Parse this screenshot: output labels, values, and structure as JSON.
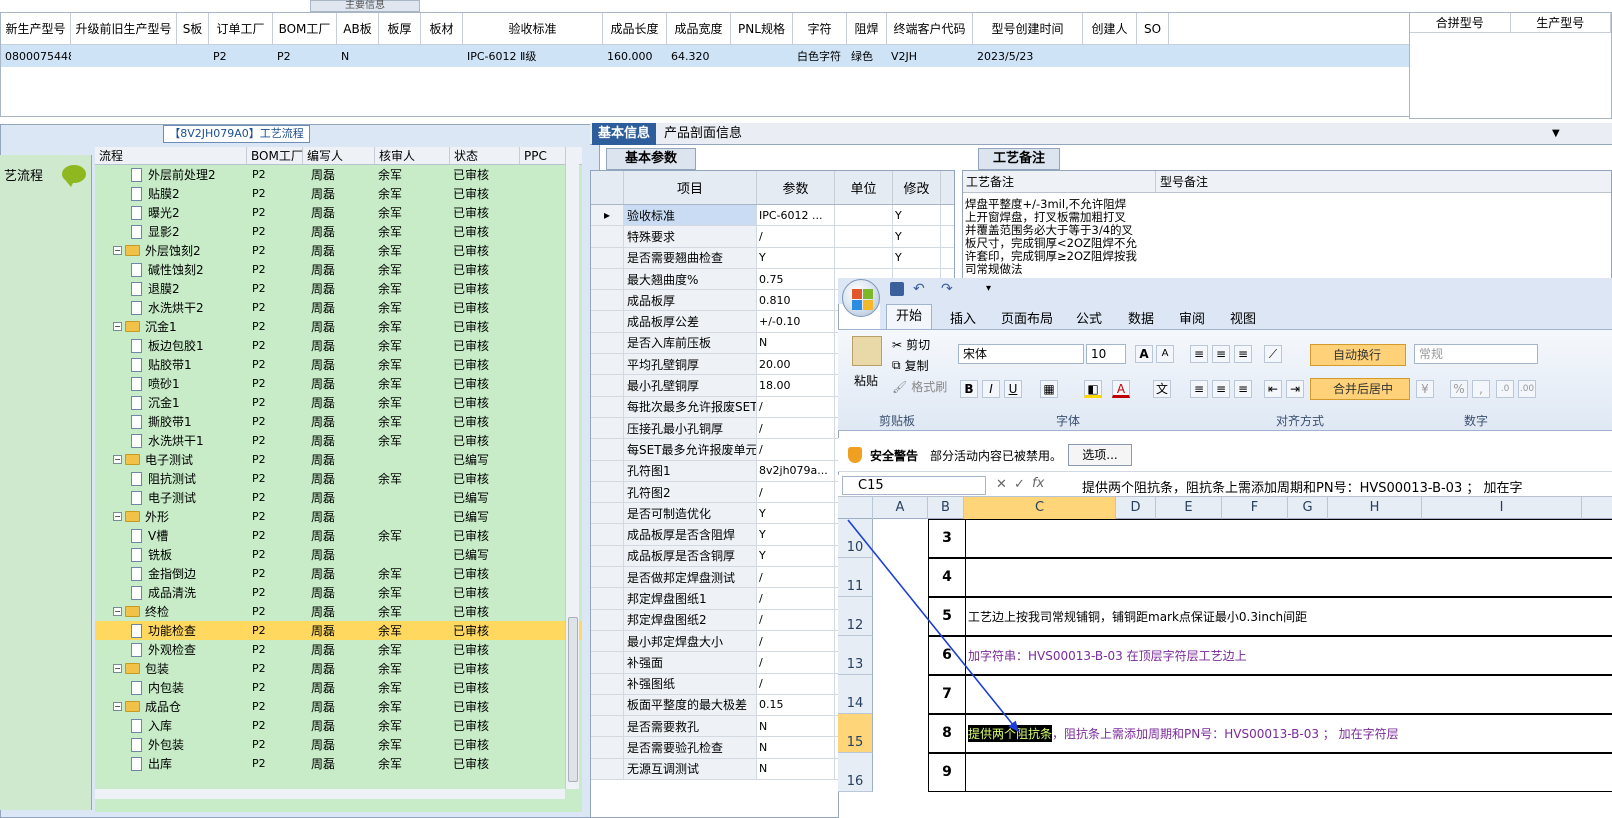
{
  "window": {
    "title_tab": "主要信息"
  },
  "top_table": {
    "headers": [
      "新生产型号",
      "升级前旧生产型号",
      "S板",
      "订单工厂",
      "BOM工厂",
      "AB板",
      "板厚",
      "板材",
      "验收标准",
      "成品长度",
      "成品宽度",
      "PNL规格",
      "字符",
      "阻焊",
      "终端客户代码",
      "型号创建时间",
      "创建人",
      "SO"
    ],
    "row": [
      "0800075448",
      "",
      "",
      "P2",
      "P2",
      "N",
      "",
      "",
      "IPC-6012 Ⅱ级",
      "160.000",
      "64.320",
      "",
      "白色字符",
      "绿色",
      "V2JH",
      "2023/5/23",
      "",
      ""
    ]
  },
  "merge_table": {
    "headers": [
      "合拼型号",
      "生产型号"
    ]
  },
  "process": {
    "title": "【8V2JH079A0】工艺流程",
    "nav_label": "艺流程",
    "headers": [
      "流程",
      "BOM工厂",
      "编写人",
      "核审人",
      "状态",
      "PPC"
    ],
    "rows": [
      {
        "level": 2,
        "type": "doc",
        "name": "外层前处理2",
        "bom": "P2",
        "writer": "周磊",
        "auditor": "余军",
        "status": "已审核"
      },
      {
        "level": 2,
        "type": "doc",
        "name": "贴膜2",
        "bom": "P2",
        "writer": "周磊",
        "auditor": "余军",
        "status": "已审核"
      },
      {
        "level": 2,
        "type": "doc",
        "name": "曝光2",
        "bom": "P2",
        "writer": "周磊",
        "auditor": "余军",
        "status": "已审核"
      },
      {
        "level": 2,
        "type": "doc",
        "name": "显影2",
        "bom": "P2",
        "writer": "周磊",
        "auditor": "余军",
        "status": "已审核"
      },
      {
        "level": 1,
        "type": "folder",
        "name": "外层蚀刻2",
        "bom": "P2",
        "writer": "周磊",
        "auditor": "余军",
        "status": "已审核"
      },
      {
        "level": 2,
        "type": "doc",
        "name": "碱性蚀刻2",
        "bom": "P2",
        "writer": "周磊",
        "auditor": "余军",
        "status": "已审核"
      },
      {
        "level": 2,
        "type": "doc",
        "name": "退膜2",
        "bom": "P2",
        "writer": "周磊",
        "auditor": "余军",
        "status": "已审核"
      },
      {
        "level": 2,
        "type": "doc",
        "name": "水洗烘干2",
        "bom": "P2",
        "writer": "周磊",
        "auditor": "余军",
        "status": "已审核"
      },
      {
        "level": 1,
        "type": "folder",
        "name": "沉金1",
        "bom": "P2",
        "writer": "周磊",
        "auditor": "余军",
        "status": "已审核"
      },
      {
        "level": 2,
        "type": "doc",
        "name": "板边包胶1",
        "bom": "P2",
        "writer": "周磊",
        "auditor": "余军",
        "status": "已审核"
      },
      {
        "level": 2,
        "type": "doc",
        "name": "贴胶带1",
        "bom": "P2",
        "writer": "周磊",
        "auditor": "余军",
        "status": "已审核"
      },
      {
        "level": 2,
        "type": "doc",
        "name": "喷砂1",
        "bom": "P2",
        "writer": "周磊",
        "auditor": "余军",
        "status": "已审核"
      },
      {
        "level": 2,
        "type": "doc",
        "name": "沉金1",
        "bom": "P2",
        "writer": "周磊",
        "auditor": "余军",
        "status": "已审核"
      },
      {
        "level": 2,
        "type": "doc",
        "name": "撕胶带1",
        "bom": "P2",
        "writer": "周磊",
        "auditor": "余军",
        "status": "已审核"
      },
      {
        "level": 2,
        "type": "doc",
        "name": "水洗烘干1",
        "bom": "P2",
        "writer": "周磊",
        "auditor": "余军",
        "status": "已审核"
      },
      {
        "level": 1,
        "type": "folder",
        "name": "电子测试",
        "bom": "P2",
        "writer": "周磊",
        "auditor": "",
        "status": "已编写"
      },
      {
        "level": 2,
        "type": "doc",
        "name": "阻抗测试",
        "bom": "P2",
        "writer": "周磊",
        "auditor": "余军",
        "status": "已审核"
      },
      {
        "level": 2,
        "type": "doc",
        "name": "电子测试",
        "bom": "P2",
        "writer": "周磊",
        "auditor": "",
        "status": "已编写"
      },
      {
        "level": 1,
        "type": "folder",
        "name": "外形",
        "bom": "P2",
        "writer": "周磊",
        "auditor": "",
        "status": "已编写"
      },
      {
        "level": 2,
        "type": "doc",
        "name": "V槽",
        "bom": "P2",
        "writer": "周磊",
        "auditor": "余军",
        "status": "已审核"
      },
      {
        "level": 2,
        "type": "doc",
        "name": "铣板",
        "bom": "P2",
        "writer": "周磊",
        "auditor": "",
        "status": "已编写"
      },
      {
        "level": 2,
        "type": "doc",
        "name": "金指倒边",
        "bom": "P2",
        "writer": "周磊",
        "auditor": "余军",
        "status": "已审核"
      },
      {
        "level": 2,
        "type": "doc",
        "name": "成品清洗",
        "bom": "P2",
        "writer": "周磊",
        "auditor": "余军",
        "status": "已审核"
      },
      {
        "level": 1,
        "type": "folder",
        "name": "终检",
        "bom": "P2",
        "writer": "周磊",
        "auditor": "余军",
        "status": "已审核"
      },
      {
        "level": 2,
        "type": "doc",
        "name": "功能检查",
        "bom": "P2",
        "writer": "周磊",
        "auditor": "余军",
        "status": "已审核",
        "selected": true
      },
      {
        "level": 2,
        "type": "doc",
        "name": "外观检查",
        "bom": "P2",
        "writer": "周磊",
        "auditor": "余军",
        "status": "已审核"
      },
      {
        "level": 1,
        "type": "folder",
        "name": "包装",
        "bom": "P2",
        "writer": "周磊",
        "auditor": "余军",
        "status": "已审核"
      },
      {
        "level": 2,
        "type": "doc",
        "name": "内包装",
        "bom": "P2",
        "writer": "周磊",
        "auditor": "余军",
        "status": "已审核"
      },
      {
        "level": 1,
        "type": "folder",
        "name": "成品仓",
        "bom": "P2",
        "writer": "周磊",
        "auditor": "余军",
        "status": "已审核"
      },
      {
        "level": 2,
        "type": "doc",
        "name": "入库",
        "bom": "P2",
        "writer": "周磊",
        "auditor": "余军",
        "status": "已审核"
      },
      {
        "level": 2,
        "type": "doc",
        "name": "外包装",
        "bom": "P2",
        "writer": "周磊",
        "auditor": "余军",
        "status": "已审核"
      },
      {
        "level": 2,
        "type": "doc",
        "name": "出库",
        "bom": "P2",
        "writer": "周磊",
        "auditor": "余军",
        "status": "已审核"
      }
    ]
  },
  "info": {
    "tabs": [
      "基本信息",
      "产品剖面信息"
    ],
    "param_tab": "基本参数",
    "remark_tab": "工艺备注",
    "param_headers": [
      "项目",
      "参数",
      "单位",
      "修改"
    ],
    "params": [
      {
        "name": "验收标准",
        "value": "IPC-6012 ...",
        "unit": "",
        "mod": "Y"
      },
      {
        "name": "特殊要求",
        "value": "/",
        "unit": "",
        "mod": "Y"
      },
      {
        "name": "是否需要翘曲检查",
        "value": "Y",
        "unit": "",
        "mod": "Y"
      },
      {
        "name": "最大翘曲度%",
        "value": "0.75",
        "unit": "",
        "mod": ""
      },
      {
        "name": "成品板厚",
        "value": "0.810",
        "unit": "",
        "mod": ""
      },
      {
        "name": "成品板厚公差",
        "value": "+/-0.10",
        "unit": "",
        "mod": ""
      },
      {
        "name": "是否入库前压板",
        "value": "N",
        "unit": "",
        "mod": ""
      },
      {
        "name": "平均孔壁铜厚",
        "value": "20.00",
        "unit": "",
        "mod": ""
      },
      {
        "name": "最小孔壁铜厚",
        "value": "18.00",
        "unit": "",
        "mod": ""
      },
      {
        "name": "每批次最多允许报废SET",
        "value": "/",
        "unit": "",
        "mod": ""
      },
      {
        "name": "压接孔最小孔铜厚",
        "value": "/",
        "unit": "",
        "mod": ""
      },
      {
        "name": "每SET最多允许报废单元",
        "value": "/",
        "unit": "",
        "mod": ""
      },
      {
        "name": "孔符图1",
        "value": "8v2jh079a...",
        "unit": "",
        "mod": ""
      },
      {
        "name": "孔符图2",
        "value": "/",
        "unit": "",
        "mod": ""
      },
      {
        "name": "是否可制造优化",
        "value": "Y",
        "unit": "",
        "mod": ""
      },
      {
        "name": "成品板厚是否含阻焊",
        "value": "Y",
        "unit": "",
        "mod": ""
      },
      {
        "name": "成品板厚是否含铜厚",
        "value": "Y",
        "unit": "",
        "mod": ""
      },
      {
        "name": "是否做邦定焊盘测试",
        "value": "/",
        "unit": "",
        "mod": ""
      },
      {
        "name": "邦定焊盘图纸1",
        "value": "/",
        "unit": "",
        "mod": ""
      },
      {
        "name": "邦定焊盘图纸2",
        "value": "/",
        "unit": "",
        "mod": ""
      },
      {
        "name": "最小邦定焊盘大小",
        "value": "/",
        "unit": "",
        "mod": ""
      },
      {
        "name": "补强面",
        "value": "/",
        "unit": "",
        "mod": ""
      },
      {
        "name": "补强图纸",
        "value": "/",
        "unit": "",
        "mod": ""
      },
      {
        "name": "板面平整度的最大极差",
        "value": "0.15",
        "unit": "",
        "mod": ""
      },
      {
        "name": "是否需要救孔",
        "value": "N",
        "unit": "",
        "mod": ""
      },
      {
        "name": "是否需要验孔检查",
        "value": "N",
        "unit": "",
        "mod": ""
      },
      {
        "name": "无源互调测试",
        "value": "N",
        "unit": "",
        "mod": ""
      }
    ],
    "remark_headers": [
      "工艺备注",
      "型号备注"
    ],
    "remark_text": "焊盘平整度+/-3mil,不允许阻焊上开窗焊盘，打叉板需加粗打叉并覆盖范围务必大于等于3/4的叉板尺寸，完成铜厚<2OZ阻焊不允许套印，完成铜厚≥2OZ阻焊按我司常规做法"
  },
  "excel": {
    "tabs": [
      "开始",
      "插入",
      "页面布局",
      "公式",
      "数据",
      "审阅",
      "视图"
    ],
    "groups": [
      "剪贴板",
      "字体",
      "对齐方式",
      "数字"
    ],
    "paste": "粘贴",
    "cut": "剪切",
    "copy": "复制",
    "format_painter": "格式刷",
    "font": "宋体",
    "font_size": "10",
    "wrap": "自动换行",
    "merge": "合并后居中",
    "number_format": "常规",
    "security_title": "安全警告",
    "security_msg": "部分活动内容已被禁用。",
    "options": "选项...",
    "namebox": "C15",
    "formula": "提供两个阻抗条，阻抗条上需添加周期和PN号：HVS00013-B-03  ；  加在字",
    "columns": [
      "A",
      "B",
      "C",
      "D",
      "E",
      "F",
      "G",
      "H",
      "I"
    ],
    "row_headers": [
      "10",
      "11",
      "12",
      "13",
      "14",
      "15",
      "16"
    ],
    "rows": [
      {
        "num": "3",
        "text": ""
      },
      {
        "num": "4",
        "text": ""
      },
      {
        "num": "5",
        "text": "工艺边上按我司常规铺铜，铺铜距mark点保证最小0.3inch间距"
      },
      {
        "num": "6",
        "text": "加字符串：HVS00013-B-03  在顶层字符层工艺边上"
      },
      {
        "num": "7",
        "text": ""
      },
      {
        "num": "8",
        "hl": "提供两个阻抗条",
        "text": "，阻抗条上需添加周期和PN号：HVS00013-B-03   ；  加在字符层"
      },
      {
        "num": "9",
        "text": ""
      }
    ]
  }
}
